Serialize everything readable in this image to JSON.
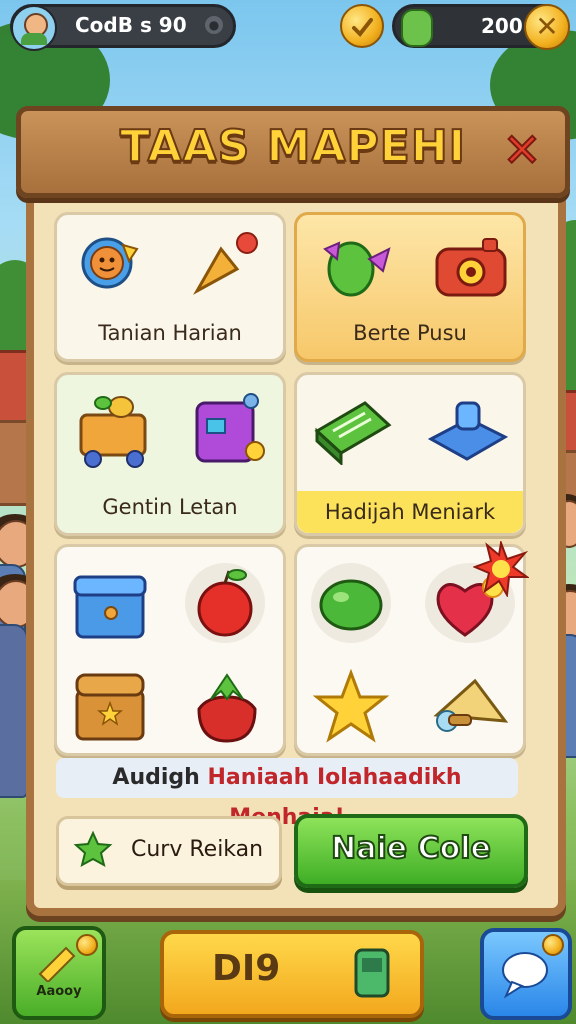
{
  "topbar": {
    "player_name": "CodB s 90",
    "currency_value": "200"
  },
  "window": {
    "title": "TAAS MAPEHI",
    "close_symbol": "✕"
  },
  "cards": [
    {
      "label": "Tanian Harian",
      "icons": [
        "smiley-badge-icon",
        "bell-icon"
      ]
    },
    {
      "label": "Berte Pusu",
      "icons": [
        "leaf-fish-icon",
        "camera-icon"
      ]
    },
    {
      "label": "Gentin Letan",
      "icons": [
        "toy-cart-icon",
        "gift-cube-icon"
      ]
    },
    {
      "label": "Hadijah Meniark",
      "icons": [
        "ticket-box-icon",
        "scanner-device-icon"
      ]
    }
  ],
  "reward_items": {
    "left": [
      "blue-chest-icon",
      "apple-icon",
      "treasure-chest-icon",
      "strawberry-icon"
    ],
    "right": [
      "lime-icon",
      "heart-fruit-icon",
      "star-icon",
      "cone-bag-icon"
    ]
  },
  "banner": {
    "part1": "Audigh ",
    "part2": "Haniaah Iolahaadikh Menhaia!"
  },
  "buttons": {
    "secondary_label": "Curv Reikan",
    "primary_label": "Naie Cole"
  },
  "bottom_bar": {
    "left_label": "Aaooy",
    "center_label": "DI9"
  },
  "colors": {
    "title": "#ffd23a",
    "primary_button": "#3fae25",
    "close": "#e23c2a",
    "highlight_card": "#f7c86a"
  }
}
